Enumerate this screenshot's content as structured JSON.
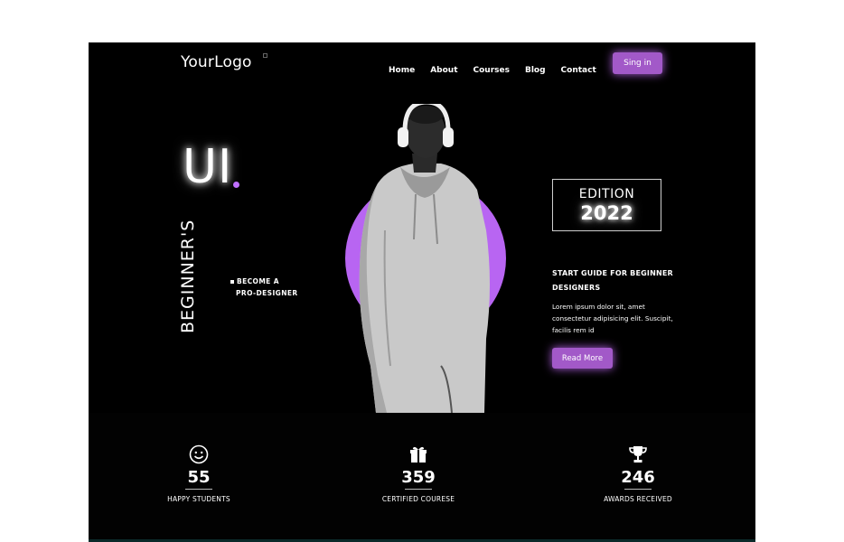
{
  "header": {
    "logo": "YourLogo",
    "nav": [
      "Home",
      "About",
      "Courses",
      "Blog",
      "Contact"
    ],
    "signin_label": "Sing in"
  },
  "hero": {
    "title": "UI",
    "vertical_text": "BEGINNER'S",
    "tagline_line1": "BECOME A",
    "tagline_line2": "PRO-DESIGNER",
    "edition_label": "EDITION",
    "edition_year": "2022",
    "guide_title": "START GUIDE FOR BEGINNER DESIGNERS",
    "guide_text": "Lorem ipsum dolor sit, amet consectetur adipisicing elit. Suscipit, facilis rem id",
    "read_more_label": "Read More"
  },
  "stats": [
    {
      "icon": "smiley-icon",
      "value": "55",
      "label": "HAPPY STUDENTS"
    },
    {
      "icon": "gift-icon",
      "value": "359",
      "label": "CERTIFIED COURESE"
    },
    {
      "icon": "trophy-icon",
      "value": "246",
      "label": "AWARDS RECEIVED"
    }
  ],
  "colors": {
    "accent": "#b865f2",
    "button": "#a259c8",
    "background": "#000000"
  }
}
